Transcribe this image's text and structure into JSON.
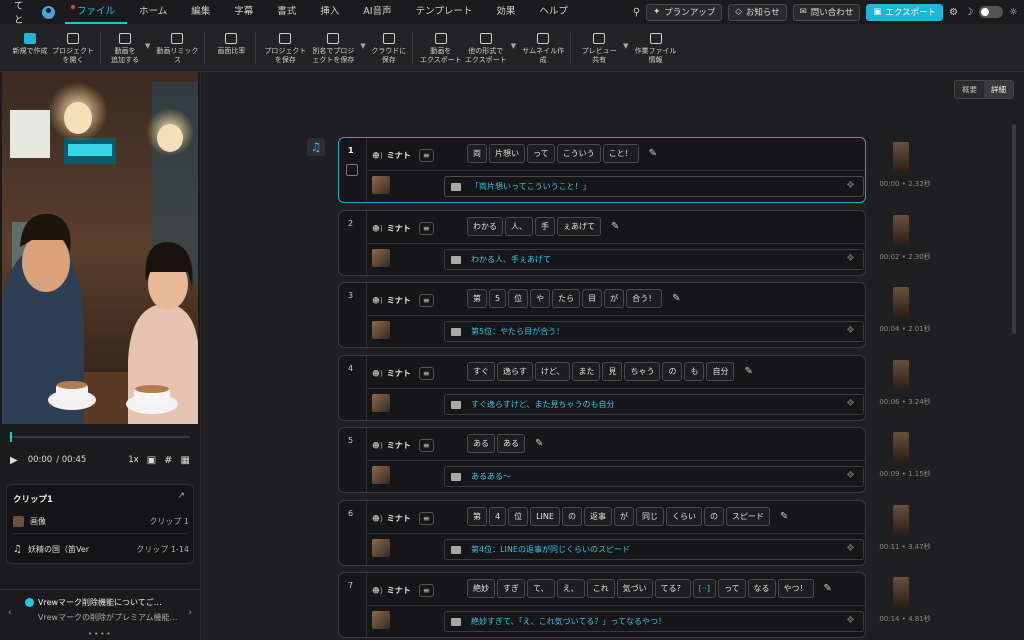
{
  "menubar": {
    "app_name": "てと",
    "menus": [
      "ファイル",
      "ホーム",
      "編集",
      "字幕",
      "書式",
      "挿入",
      "AI音声",
      "テンプレート",
      "効果",
      "ヘルプ"
    ],
    "active_menu": "ファイル",
    "plan_up": "プランアップ",
    "notifications": "お知らせ",
    "contact": "問い合わせ",
    "export": "エクスポート"
  },
  "toolbar": {
    "new": "新規で作成",
    "open": "プロジェクト\nを開く",
    "add_video": "動画を\n追加する",
    "remix": "動画リミック\nス",
    "ratio": "画面比率",
    "save": "プロジェクト\nを保存",
    "save_as": "別名でプロジ\nェクトを保存",
    "cloud": "クラウドに\n保存",
    "export_video": "動画を\nエクスポート",
    "export_other": "他の形式で\nエクスポート",
    "thumbnail": "サムネイル作\n成",
    "preview": "プレビュー\n共有",
    "project_info": "作業ファイル\n情報"
  },
  "player": {
    "time_current": "00:00",
    "time_total": "/ 00:45",
    "speed": "1x",
    "progress": 0.0
  },
  "clip_panel": {
    "title": "クリップ1",
    "rows": [
      {
        "label": "画像",
        "right": "クリップ 1"
      },
      {
        "label": "妖精の国（笛Ver",
        "right": "クリップ 1-14"
      }
    ]
  },
  "notice": {
    "title": "Vrewマーク削除機能についてご…",
    "body": "Vrewマークの削除がプレミアム機能…"
  },
  "view_toggle": {
    "summary": "概要",
    "detail": "詳細"
  },
  "rows": [
    {
      "num": "1",
      "speaker": "ミナト",
      "chips": [
        "両",
        "片想い",
        "って",
        "こういう",
        "こと！"
      ],
      "subtitle": "「両片想いってこういうこと！」",
      "time": "00:00 • 2.32秒",
      "selected": true
    },
    {
      "num": "2",
      "speaker": "ミナト",
      "chips": [
        "わかる",
        "人、",
        "手",
        "ぇあげて"
      ],
      "subtitle": "わかる人、手ぇあげて",
      "time": "00:02 • 2.30秒",
      "selected": false
    },
    {
      "num": "3",
      "speaker": "ミナト",
      "chips": [
        "第",
        "5",
        "位",
        "や",
        "たら",
        "目",
        "が",
        "合う！"
      ],
      "subtitle": "第5位：やたら目が合う！",
      "time": "00:04 • 2.01秒",
      "selected": false
    },
    {
      "num": "4",
      "speaker": "ミナト",
      "chips": [
        "すぐ",
        "逸らす",
        "けど、",
        "また",
        "見",
        "ちゃう",
        "の",
        "も",
        "自分"
      ],
      "subtitle": "すぐ逸らすけど、また見ちゃうのも自分",
      "time": "00:06 • 3.24秒",
      "selected": false
    },
    {
      "num": "5",
      "speaker": "ミナト",
      "chips": [
        "ある",
        "ある"
      ],
      "subtitle": "あるある〜",
      "time": "00:09 • 1.15秒",
      "selected": false
    },
    {
      "num": "6",
      "speaker": "ミナト",
      "chips": [
        "第",
        "4",
        "位",
        "LINE",
        "の",
        "返事",
        "が",
        "同じ",
        "くらい",
        "の",
        "スピード"
      ],
      "subtitle": "第4位：LINEの返事が同じくらいのスピード",
      "time": "00:11 • 3.47秒",
      "selected": false
    },
    {
      "num": "7",
      "speaker": "ミナト",
      "chips": [
        "絶妙",
        "すぎ",
        "て、",
        "え、",
        "これ",
        "気づい",
        "てる？",
        "[··]",
        "って",
        "なる",
        "やつ！"
      ],
      "subtitle": "絶妙すぎて、「え、これ気づいてる？」ってなるやつ！",
      "time": "00:14 • 4.81秒",
      "selected": false
    }
  ],
  "colors": {
    "accent": "#25c1de",
    "export": "#1fb5d6",
    "dot": "#e8452c"
  }
}
